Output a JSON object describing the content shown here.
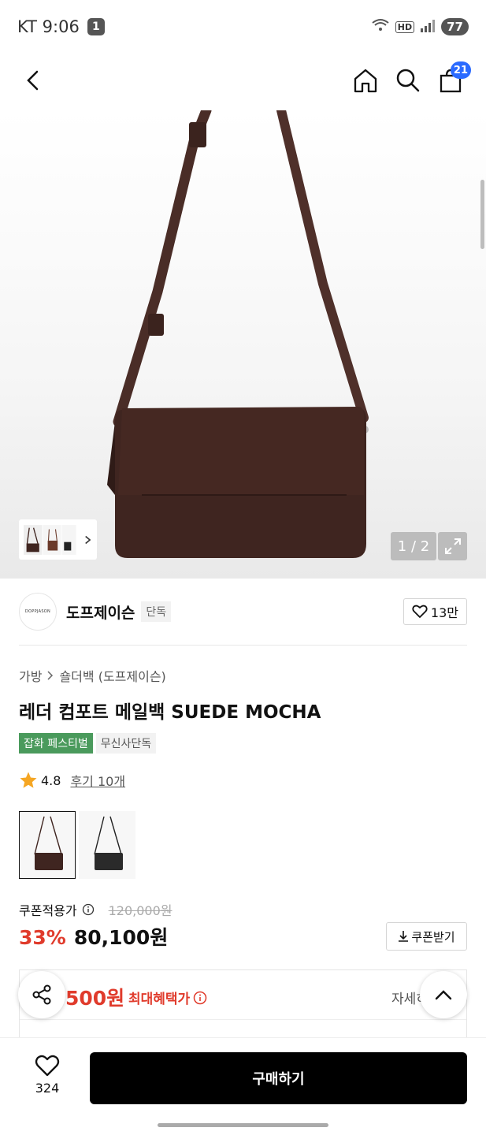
{
  "status_bar": {
    "carrier_time": "KT 9:06",
    "notification_count": "1",
    "network": "HD",
    "battery": "77"
  },
  "nav": {
    "cart_count": "21"
  },
  "hero": {
    "page_counter": "1 / 2"
  },
  "brand": {
    "logo_text": "DOPPJASON",
    "name": "도프제이슨",
    "exclusive": "단독",
    "likes": "13만"
  },
  "breadcrumb": {
    "category": "가방",
    "subcategory": "숄더백 (도프제이슨)"
  },
  "product": {
    "title": "레더 컴포트 메일백 SUEDE MOCHA",
    "tags": [
      "잡화 페스티벌",
      "무신사단독"
    ],
    "rating": "4.8",
    "review_link": "후기 10개"
  },
  "pricing": {
    "coupon_label": "쿠폰적용가",
    "original_price": "120,000원",
    "discount": "33%",
    "price": "80,100원",
    "coupon_button": "쿠폰받기"
  },
  "benefit": {
    "amount": "500원",
    "label": "최대혜택가",
    "detail": "자세히"
  },
  "bottom": {
    "wish_count": "324",
    "buy_label": "구매하기"
  },
  "colors": {
    "accent_red": "#e03b2c",
    "badge_blue": "#2b6bff",
    "tag_green": "#4a9a5c",
    "bag_brown": "#3f2520"
  }
}
